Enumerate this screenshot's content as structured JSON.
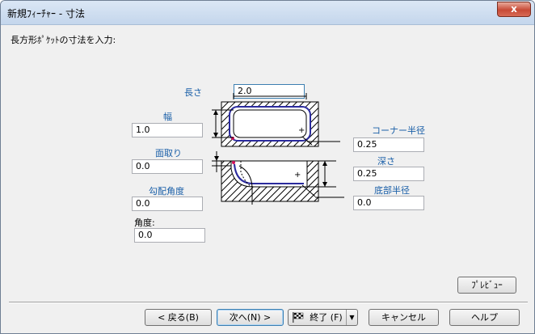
{
  "window": {
    "title": "新規ﾌｨｰﾁｬｰ - 寸法",
    "close_label": "x"
  },
  "prompt": "長方形ﾎﾟｹｯﾄの寸法を入力:",
  "fields": {
    "length": {
      "label": "長さ",
      "value": "2.0"
    },
    "width": {
      "label": "幅",
      "value": "1.0"
    },
    "chamfer": {
      "label": "面取り",
      "value": "0.0"
    },
    "draft": {
      "label": "勾配角度",
      "value": "0.0"
    },
    "angle": {
      "label": "角度:",
      "value": "0.0"
    },
    "corner_radius": {
      "label": "コーナー半径",
      "value": "0.25"
    },
    "depth": {
      "label": "深さ",
      "value": "0.25"
    },
    "bottom_radius": {
      "label": "底部半径",
      "value": "0.0"
    }
  },
  "buttons": {
    "preview": "ﾌﾟﾚﾋﾞｭｰ",
    "back": "< 戻る(B)",
    "next": "次へ(N) >",
    "finish": "終了 (F)",
    "cancel": "キャンセル",
    "help": "ヘルプ"
  },
  "icons": {
    "finish": "checkered-flag-icon",
    "dropdown": "chevron-down-icon"
  },
  "colors": {
    "label_blue": "#1a5fa8",
    "pocket_outline": "#2b2b9e",
    "corner_marker": "#d4145a"
  }
}
